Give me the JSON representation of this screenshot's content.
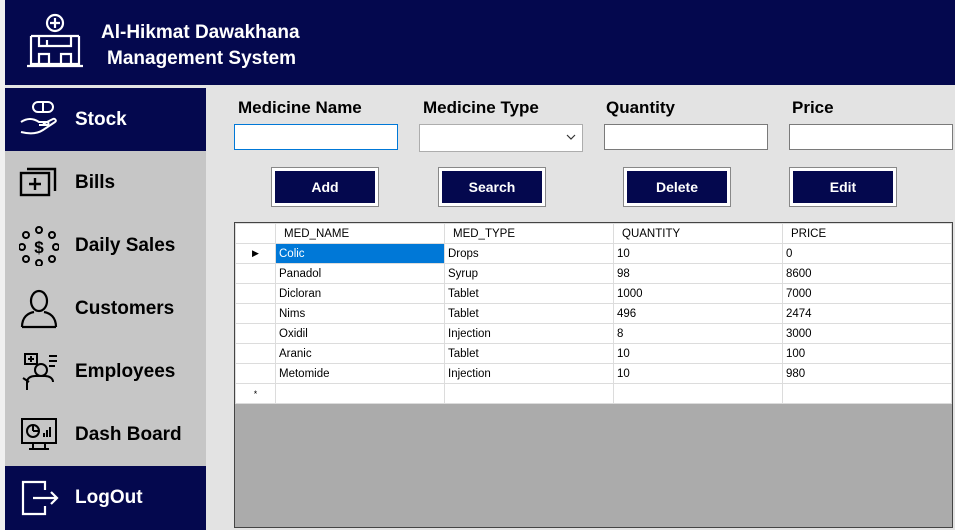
{
  "app": {
    "title_line1": "Al-Hikmat Dawakhana",
    "title_line2": "Management System",
    "logo_icon": "pharmacy-icon"
  },
  "sidebar": {
    "items": [
      {
        "label": "Stock",
        "icon": "hand-pill-icon",
        "active": true
      },
      {
        "label": "Bills",
        "icon": "bill-icon",
        "active": false
      },
      {
        "label": "Daily Sales",
        "icon": "sales-icon",
        "active": false
      },
      {
        "label": "Customers",
        "icon": "user-icon",
        "active": false
      },
      {
        "label": "Employees",
        "icon": "employee-icon",
        "active": false
      },
      {
        "label": "Dash Board",
        "icon": "dashboard-icon",
        "active": false
      },
      {
        "label": "LogOut",
        "icon": "logout-icon",
        "active": true
      }
    ]
  },
  "form": {
    "labels": {
      "name": "Medicine Name",
      "type": "Medicine Type",
      "quantity": "Quantity",
      "price": "Price"
    },
    "values": {
      "name": "",
      "type": "",
      "quantity": "",
      "price": ""
    }
  },
  "buttons": {
    "add": "Add",
    "search": "Search",
    "delete": "Delete",
    "edit": "Edit"
  },
  "table": {
    "columns": [
      "MED_NAME",
      "MED_TYPE",
      "QUANTITY",
      "PRICE"
    ],
    "rows": [
      [
        "Colic",
        "Drops",
        "10",
        "0"
      ],
      [
        "Panadol",
        "Syrup",
        "98",
        "8600"
      ],
      [
        "Dicloran",
        "Tablet",
        "1000",
        "7000"
      ],
      [
        "Nims",
        "Tablet",
        "496",
        "2474"
      ],
      [
        "Oxidil",
        "Injection",
        "8",
        "3000"
      ],
      [
        "Aranic",
        "Tablet",
        "10",
        "100"
      ],
      [
        "Metomide",
        "Injection",
        "10",
        "980"
      ]
    ],
    "new_row_marker": "*",
    "current_row_marker": "▶"
  },
  "colors": {
    "navy": "#04084e",
    "sidebar_gray": "#c6c6c6",
    "selection": "#0078d7",
    "grid_bg": "#ababab"
  }
}
